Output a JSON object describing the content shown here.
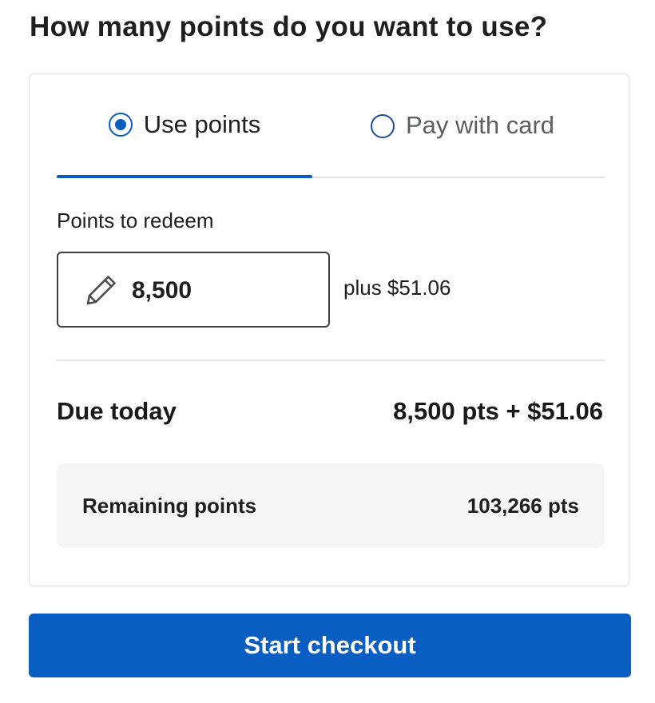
{
  "heading": "How many points do you want to use?",
  "tabs": [
    {
      "label": "Use points",
      "selected": true
    },
    {
      "label": "Pay with card",
      "selected": false
    }
  ],
  "redeem": {
    "label": "Points to redeem",
    "value": "8,500",
    "icon": "pencil-icon",
    "plus_text": "plus $51.06"
  },
  "due": {
    "label": "Due today",
    "value": "8,500 pts + $51.06"
  },
  "remaining": {
    "label": "Remaining points",
    "value": "103,266 pts"
  },
  "checkout": {
    "label": "Start checkout"
  },
  "colors": {
    "accent": "#0a5ec1",
    "summary_background": "#f4f5f7",
    "border": "#dcdfe3"
  }
}
